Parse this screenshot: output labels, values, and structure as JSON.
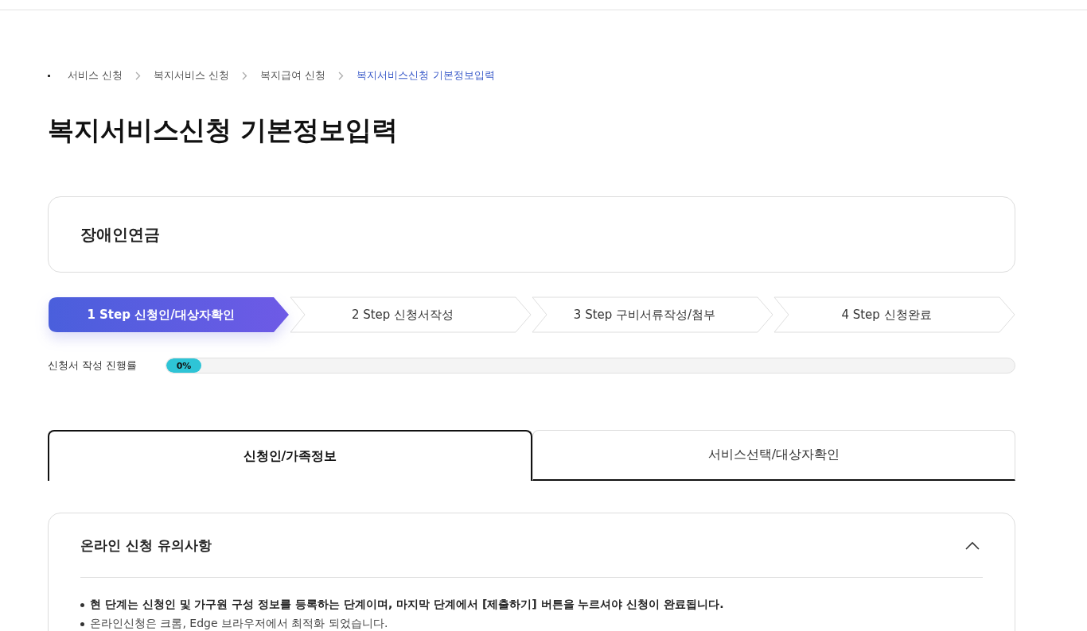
{
  "breadcrumb": [
    {
      "label": "서비스 신청",
      "current": false
    },
    {
      "label": "복지서비스 신청",
      "current": false
    },
    {
      "label": "복지급여 신청",
      "current": false
    },
    {
      "label": "복지서비스신청 기본정보입력",
      "current": true
    }
  ],
  "page_title": "복지서비스신청 기본정보입력",
  "service_name": "장애인연금",
  "steps": [
    {
      "label": "1 Step 신청인/대상자확인",
      "selected": true
    },
    {
      "label": "2 Step 신청서작성",
      "selected": false
    },
    {
      "label": "3 Step 구비서류작성/첨부",
      "selected": false
    },
    {
      "label": "4 Step 신청완료",
      "selected": false
    }
  ],
  "progress": {
    "label": "신청서 작성 진행률",
    "level": 0,
    "reading": "0%"
  },
  "tabs": [
    {
      "label": "신청인/가족정보",
      "selected": true
    },
    {
      "label": "서비스선택/대상자확인",
      "selected": false
    }
  ],
  "notice": {
    "title": "온라인 신청 유의사항",
    "expanded": true,
    "items": [
      {
        "text": "현 단계는 신청인 및 가구원 구성 정보를 등록하는 단계이며, 마지막 단계에서 [제출하기] 버튼을 누르셔야 신청이 완료됩니다.",
        "bold": true
      },
      {
        "text": "온라인신청은 크롬, Edge 브라우저에서 최적화 되었습니다.",
        "bold": false
      }
    ]
  }
}
